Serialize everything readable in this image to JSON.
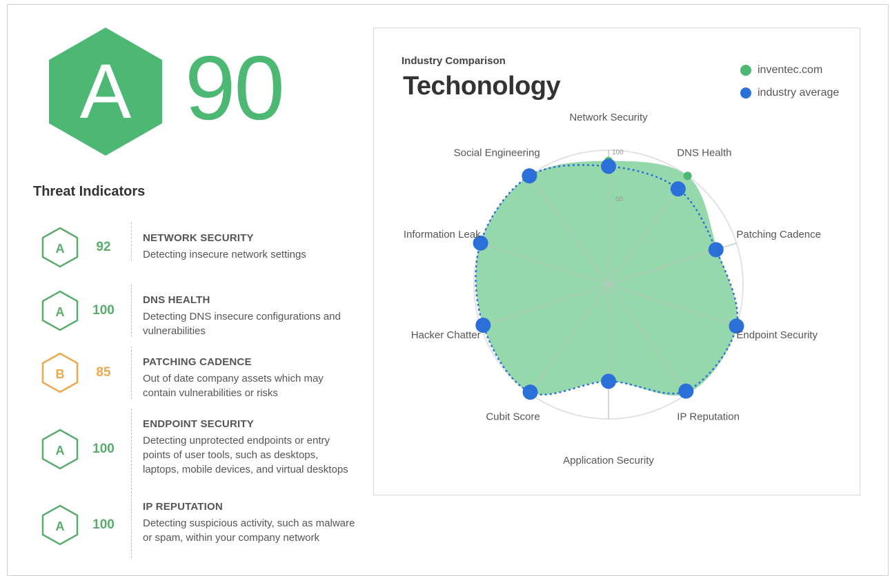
{
  "overall": {
    "grade": "A",
    "score": "90"
  },
  "colors": {
    "green": "#4cb873",
    "blue": "#2a70d8",
    "orange": "#eba94c",
    "fill": "#8fd6a6"
  },
  "threat_indicators": {
    "title": "Threat Indicators",
    "items": [
      {
        "grade": "A",
        "score": "92",
        "name": "NETWORK SECURITY",
        "desc": "Detecting insecure network settings",
        "color": "#5aab6c",
        "icon": "hexagon-grade-icon"
      },
      {
        "grade": "A",
        "score": "100",
        "name": "DNS HEALTH",
        "desc": "Detecting DNS insecure configurations and vulnerabilities",
        "color": "#5aab6c",
        "icon": "hexagon-grade-icon"
      },
      {
        "grade": "B",
        "score": "85",
        "name": "PATCHING CADENCE",
        "desc": "Out of date company assets which may contain vulnerabilities or risks",
        "color": "#eba94c",
        "icon": "hexagon-grade-icon"
      },
      {
        "grade": "A",
        "score": "100",
        "name": "ENDPOINT SECURITY",
        "desc": "Detecting unprotected endpoints or entry points of user tools, such as desktops, laptops, mobile devices, and virtual desktops",
        "color": "#5aab6c",
        "icon": "hexagon-grade-icon"
      },
      {
        "grade": "A",
        "score": "100",
        "name": "IP REPUTATION",
        "desc": "Detecting suspicious activity, such as malware or spam, within your company network",
        "color": "#5aab6c",
        "icon": "hexagon-grade-icon"
      }
    ]
  },
  "comparison": {
    "subtitle": "Industry Comparison",
    "title": "Techonology",
    "legend": [
      {
        "label": "inventec.com",
        "color": "#4cb873"
      },
      {
        "label": "industry average",
        "color": "#2a70d8"
      }
    ]
  },
  "chart_data": {
    "type": "radar",
    "title": "Techonology",
    "subtitle": "Industry Comparison",
    "axes": [
      "Network Security",
      "DNS Health",
      "Patching Cadence",
      "Endpoint Security",
      "IP Reputation",
      "Application Security",
      "Cubit Score",
      "Hacker Chatter",
      "Information Leak",
      "Social Engineering"
    ],
    "range": [
      0,
      100
    ],
    "tick_labels": [
      "60",
      "100"
    ],
    "grid": true,
    "legend_position": "top-right",
    "series": [
      {
        "name": "inventec.com",
        "color": "#4cb873",
        "values": [
          92,
          100,
          85,
          100,
          100,
          72,
          99,
          98,
          100,
          100
        ]
      },
      {
        "name": "industry average",
        "color": "#2a70d8",
        "values": [
          88,
          88,
          84,
          100,
          98,
          72,
          99,
          98,
          100,
          100
        ]
      }
    ]
  }
}
